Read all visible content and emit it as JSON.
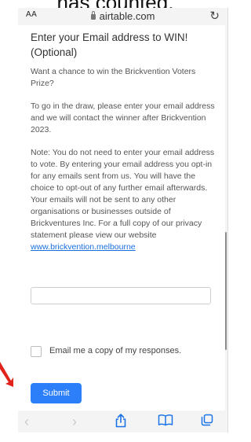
{
  "top_caption": "nas counted.",
  "browser": {
    "text_size_label": "AA",
    "url": "airtable.com",
    "reload_icon": "reload-icon"
  },
  "form": {
    "question_title": "Enter your Email address to WIN! (Optional)",
    "paragraphs": [
      "Want a chance to win the Brickvention Voters Prize?",
      "To go in the draw, please enter your email address and we will contact the winner after Brickvention 2023.",
      "Note:  You do not need to enter your email address to vote.  By entering your email address you opt-in for any emails sent from us. You will have the choice to opt-out of any further email afterwards.  Your emails will not be sent to any other organisations or businesses outside of Brickventures Inc.  For a full copy of our privacy statement please view our website "
    ],
    "privacy_link": "www.brickvention.melbourne",
    "email_input_value": "",
    "email_input_placeholder": "",
    "copy_checkbox_label": "Email me a copy of my responses.",
    "copy_checkbox_checked": false,
    "submit_label": "Submit"
  },
  "toolbar": {
    "back_icon": "‹",
    "forward_icon": "›",
    "share_icon": "⇧",
    "bookmarks_icon": "🕮",
    "tabs_icon": "⧉"
  },
  "colors": {
    "submit_bg": "#2d7ff9",
    "link": "#1a6fe0",
    "toolbar_active": "#1a73e8",
    "arrow": "#e0231b"
  }
}
